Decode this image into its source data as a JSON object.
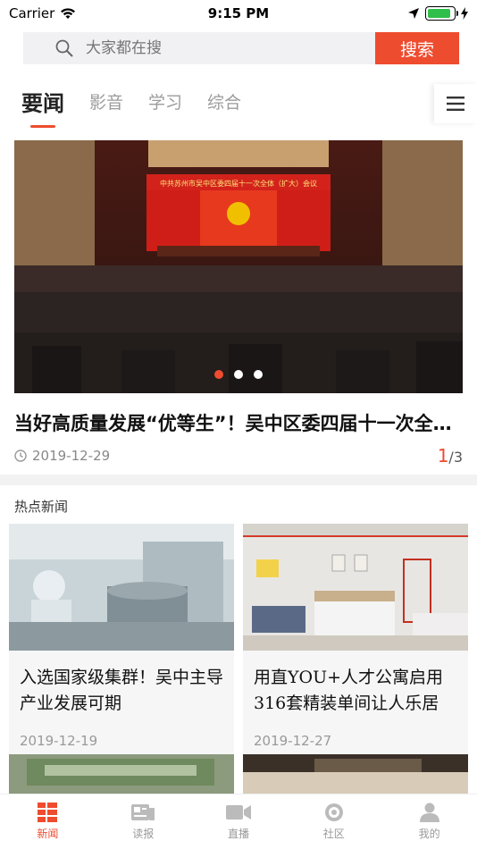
{
  "status_bar": {
    "carrier": "Carrier",
    "time": "9:15 PM",
    "battery_level": 0.9
  },
  "search": {
    "placeholder": "大家都在搜",
    "button_label": "搜索"
  },
  "tabs": [
    {
      "label": "要闻",
      "active": true
    },
    {
      "label": "影音",
      "active": false
    },
    {
      "label": "学习",
      "active": false
    },
    {
      "label": "综合",
      "active": false
    }
  ],
  "banner": {
    "slide_text": "中共苏州市吴中区委四届十一次全体（扩大）会议",
    "headline": "当好高质量发展“优等生”！吴中区委四届十一次全体（扩大）会议召开",
    "date": "2019-12-29",
    "page_current": "1",
    "page_total": "/3"
  },
  "hot_news": {
    "title": "热点新闻",
    "items": [
      {
        "title": "入选国家级集群！吴中主导产业发展可期",
        "date": "2019-12-19"
      },
      {
        "title": "用直YOU+人才公寓启用 316套精装单间让人乐居",
        "date": "2019-12-27"
      }
    ]
  },
  "tab_bar": [
    {
      "label": "新闻",
      "icon": "news-grid-icon",
      "active": true
    },
    {
      "label": "读报",
      "icon": "newspaper-icon",
      "active": false
    },
    {
      "label": "直播",
      "icon": "video-camera-icon",
      "active": false
    },
    {
      "label": "社区",
      "icon": "community-circle-icon",
      "active": false
    },
    {
      "label": "我的",
      "icon": "user-icon",
      "active": false
    }
  ],
  "colors": {
    "accent": "#ee4c2f",
    "inactive": "#999999"
  }
}
